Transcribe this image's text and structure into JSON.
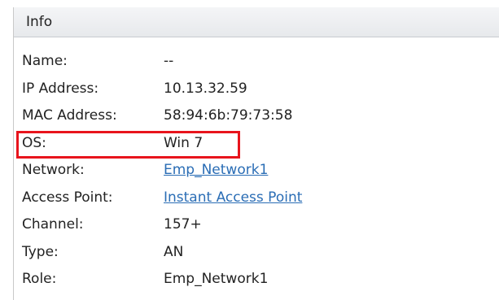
{
  "panel": {
    "title": "Info"
  },
  "rows": [
    {
      "label": "Name:",
      "value": "--"
    },
    {
      "label": "IP Address:",
      "value": "10.13.32.59"
    },
    {
      "label": "MAC Address:",
      "value": "58:94:6b:79:73:58"
    },
    {
      "label": "OS:",
      "value": "Win 7"
    },
    {
      "label": "Network:",
      "value": "Emp_Network1"
    },
    {
      "label": "Access Point:",
      "value": "Instant Access Point"
    },
    {
      "label": "Channel:",
      "value": "157+"
    },
    {
      "label": "Type:",
      "value": "AN"
    },
    {
      "label": "Role:",
      "value": "Emp_Network1"
    }
  ],
  "colors": {
    "highlight": "#e8141c",
    "link": "#2a6db5",
    "header_bg": "#eceef1",
    "text": "#222222"
  }
}
